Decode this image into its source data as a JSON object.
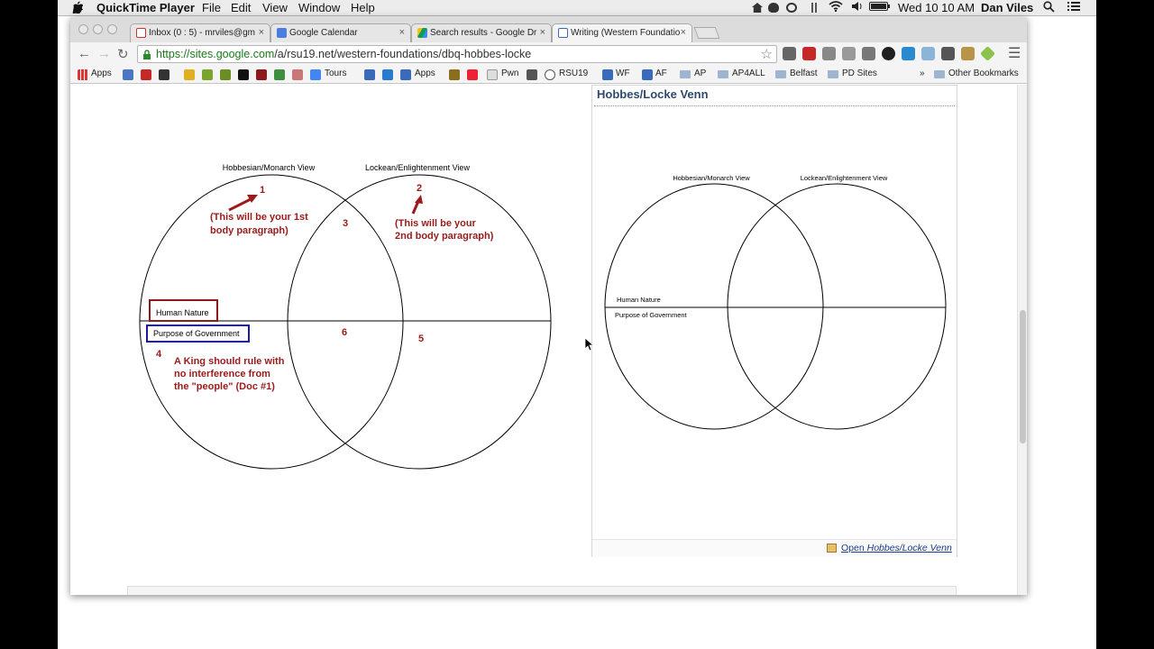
{
  "menubar": {
    "apple": "",
    "app_name": "QuickTime Player",
    "items": [
      "File",
      "Edit",
      "View",
      "Window",
      "Help"
    ],
    "clock": "Wed 10 10 AM",
    "user": "Dan Viles"
  },
  "browser": {
    "tabs": [
      {
        "title": "Inbox (0 : 5) - mrviles@gm",
        "close": "×"
      },
      {
        "title": "Google Calendar",
        "close": "×"
      },
      {
        "title": "Search results - Google Dr",
        "close": "×"
      },
      {
        "title": "Writing (Western Foundatio",
        "close": "×"
      }
    ],
    "url_host": "https://sites.google.com",
    "url_path": "/a/rsu19.net/western-foundations/dbq-hobbes-locke",
    "bookmarks": [
      "Apps",
      "Tours",
      "Apps",
      "Pwn",
      "RSU19",
      "WF",
      "AF",
      "AP",
      "AP4ALL",
      "Belfast",
      "PD Sites",
      "Other Bookmarks"
    ],
    "overflow": "»"
  },
  "colors": {
    "annotation_red": "#9b1b1b",
    "human_nature_box": "#8b1a1a",
    "purpose_box": "#1a1a9b",
    "link_blue": "#1a3d8a"
  },
  "venn_main": {
    "left_title": "Hobbesian/Monarch View",
    "right_title": "Lockean/Enlightenment View",
    "row_top": "Human Nature",
    "row_bottom": "Purpose of Government",
    "n1": "1",
    "n2": "2",
    "n3": "3",
    "n4": "4",
    "n5": "5",
    "n6": "6",
    "note1_line1": "(This will be your 1st",
    "note1_line2": "body paragraph)",
    "note2_line1": "(This will be your",
    "note2_line2": "2nd body paragraph)",
    "note3_line1": "A King should rule with",
    "note3_line2": "no interference from",
    "note3_line3": "the \"people\" (Doc #1)"
  },
  "gadget": {
    "title": "Hobbes/Locke Venn",
    "left_title": "Hobbesian/Monarch View",
    "right_title": "Lockean/Enlightenment View",
    "row_top": "Human Nature",
    "row_bottom": "Purpose of Government",
    "open_prefix": "Open ",
    "open_name": "Hobbes/Locke Venn"
  }
}
